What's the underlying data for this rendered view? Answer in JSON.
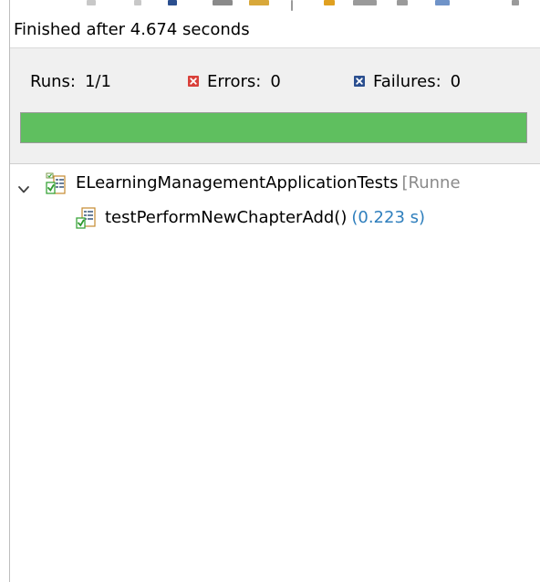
{
  "status_line": "Finished after 4.674 seconds",
  "counters": {
    "runs_label": "Runs:",
    "runs_value": "1/1",
    "errors_label": "Errors:",
    "errors_value": "0",
    "failures_label": "Failures:",
    "failures_value": "0"
  },
  "progress": {
    "fraction": 1.0,
    "color": "#5fbf5f"
  },
  "tree": {
    "suite": {
      "name": "ELearningManagementApplicationTests",
      "runner": "[Runne",
      "expanded": true,
      "icon": "test-suite-passed-icon"
    },
    "tests": [
      {
        "name": "testPerformNewChapterAdd()",
        "elapsed": "(0.223 s)",
        "icon": "test-case-passed-icon"
      }
    ]
  },
  "colors": {
    "error_icon": "#d9403a",
    "failure_icon": "#2b4f8f",
    "elapsed_text": "#2f7fbd",
    "runner_text": "#8a8a8a",
    "summary_background": "#f0f0f0"
  }
}
